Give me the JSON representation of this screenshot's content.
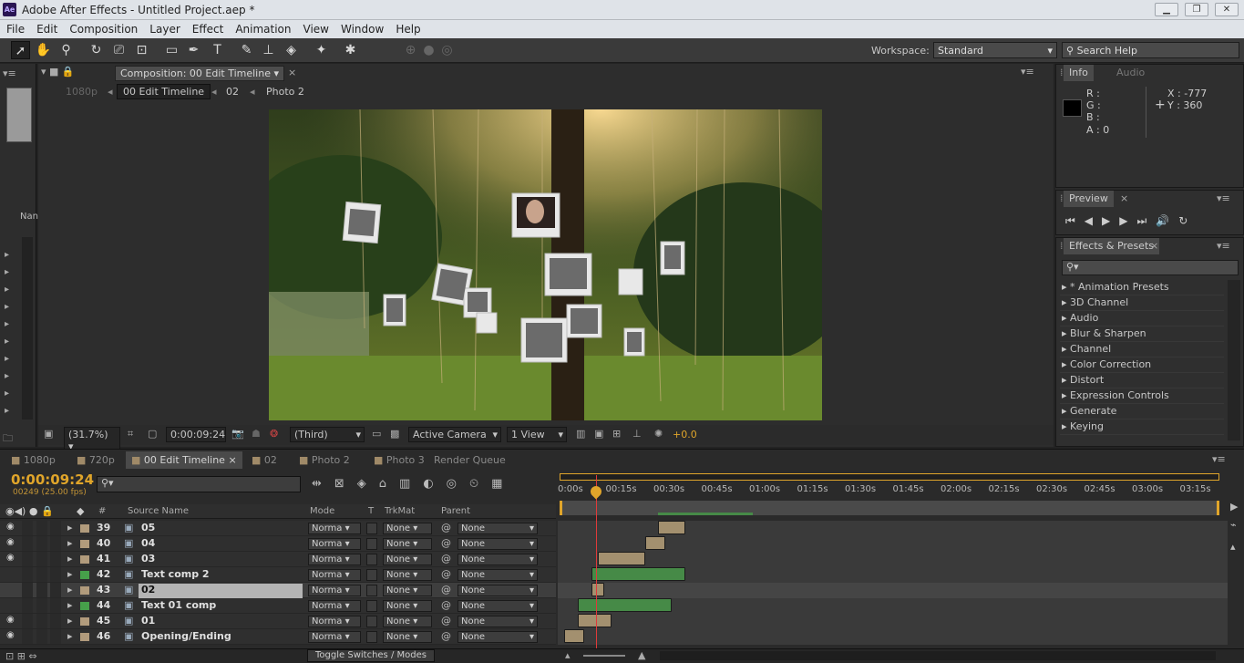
{
  "window": {
    "app_icon": "Ae",
    "title": "Adobe After Effects - Untitled Project.aep *",
    "minimize": "▁",
    "restore": "❐",
    "close": "✕"
  },
  "menu": [
    "File",
    "Edit",
    "Composition",
    "Layer",
    "Effect",
    "Animation",
    "View",
    "Window",
    "Help"
  ],
  "toolbar": {
    "workspace_label": "Workspace:",
    "workspace_value": "Standard",
    "search_placeholder": "Search Help"
  },
  "comp_panel": {
    "tab": "Composition: 00 Edit Timeline",
    "crumbs": [
      "1080p",
      "00 Edit Timeline",
      "02",
      "Photo 2"
    ]
  },
  "viewer_bar": {
    "zoom": "(31.7%)",
    "timecode": "0:00:09:24",
    "resolution": "(Third)",
    "camera": "Active Camera",
    "views": "1 View",
    "exposure": "+0.0"
  },
  "project_col": "Nan",
  "info": {
    "tabs": [
      "Info",
      "Audio"
    ],
    "r": "R :",
    "g": "G :",
    "b": "B :",
    "a": "A : 0",
    "x": "X : -777",
    "y": "Y : 360"
  },
  "preview": {
    "title": "Preview"
  },
  "effects": {
    "title": "Effects & Presets",
    "items": [
      "* Animation Presets",
      "3D Channel",
      "Audio",
      "Blur & Sharpen",
      "Channel",
      "Color Correction",
      "Distort",
      "Expression Controls",
      "Generate",
      "Keying"
    ]
  },
  "timeline": {
    "tabs": [
      "1080p",
      "720p",
      "00 Edit Timeline",
      "02",
      "Photo 2",
      "Photo 3",
      "Render Queue"
    ],
    "timecode": "0:00:09:24",
    "frames": "00249 (25.00 fps)",
    "headers": {
      "num": "#",
      "source": "Source Name",
      "mode": "Mode",
      "t": "T",
      "trkmat": "TrkMat",
      "parent": "Parent"
    },
    "ruler": [
      "0:00s",
      "00:15s",
      "00:30s",
      "00:45s",
      "01:00s",
      "01:15s",
      "01:30s",
      "01:45s",
      "02:00s",
      "02:15s",
      "02:30s",
      "02:45s",
      "03:00s",
      "03:15s"
    ],
    "layers": [
      {
        "num": "39",
        "name": "05",
        "mode": "Norma",
        "trk": "None",
        "parent": "None",
        "color": "#b19b7c",
        "eye": true,
        "bar_start": 0.15,
        "bar_len": 0.04,
        "bar_color": "#a3906f"
      },
      {
        "num": "40",
        "name": "04",
        "mode": "Norma",
        "trk": "None",
        "parent": "None",
        "color": "#b19b7c",
        "eye": true,
        "bar_start": 0.13,
        "bar_len": 0.03,
        "bar_color": "#a3906f"
      },
      {
        "num": "41",
        "name": "03",
        "mode": "Norma",
        "trk": "None",
        "parent": "None",
        "color": "#b19b7c",
        "eye": true,
        "bar_start": 0.06,
        "bar_len": 0.07,
        "bar_color": "#a3906f"
      },
      {
        "num": "42",
        "name": "Text comp 2",
        "mode": "Norma",
        "trk": "None",
        "parent": "None",
        "color": "#46a04a",
        "eye": false,
        "bar_start": 0.05,
        "bar_len": 0.14,
        "bar_color": "#468a47"
      },
      {
        "num": "43",
        "name": "02",
        "mode": "Norma",
        "trk": "None",
        "parent": "None",
        "color": "#b19b7c",
        "eye": false,
        "bar_start": 0.05,
        "bar_len": 0.02,
        "bar_color": "#a3906f",
        "selected": true
      },
      {
        "num": "44",
        "name": "Text 01 comp",
        "mode": "Norma",
        "trk": "None",
        "parent": "None",
        "color": "#46a04a",
        "eye": false,
        "bar_start": 0.03,
        "bar_len": 0.14,
        "bar_color": "#468a47"
      },
      {
        "num": "45",
        "name": "01",
        "mode": "Norma",
        "trk": "None",
        "parent": "None",
        "color": "#b19b7c",
        "eye": true,
        "bar_start": 0.03,
        "bar_len": 0.05,
        "bar_color": "#a3906f"
      },
      {
        "num": "46",
        "name": "Opening/Ending",
        "mode": "Norma",
        "trk": "None",
        "parent": "None",
        "color": "#b19b7c",
        "eye": true,
        "bar_start": 0.01,
        "bar_len": 0.03,
        "bar_color": "#a3906f"
      }
    ],
    "toggle": "Toggle Switches / Modes"
  },
  "colors": {
    "accent": "#e0a52a",
    "playhead": "#e03a3a"
  }
}
